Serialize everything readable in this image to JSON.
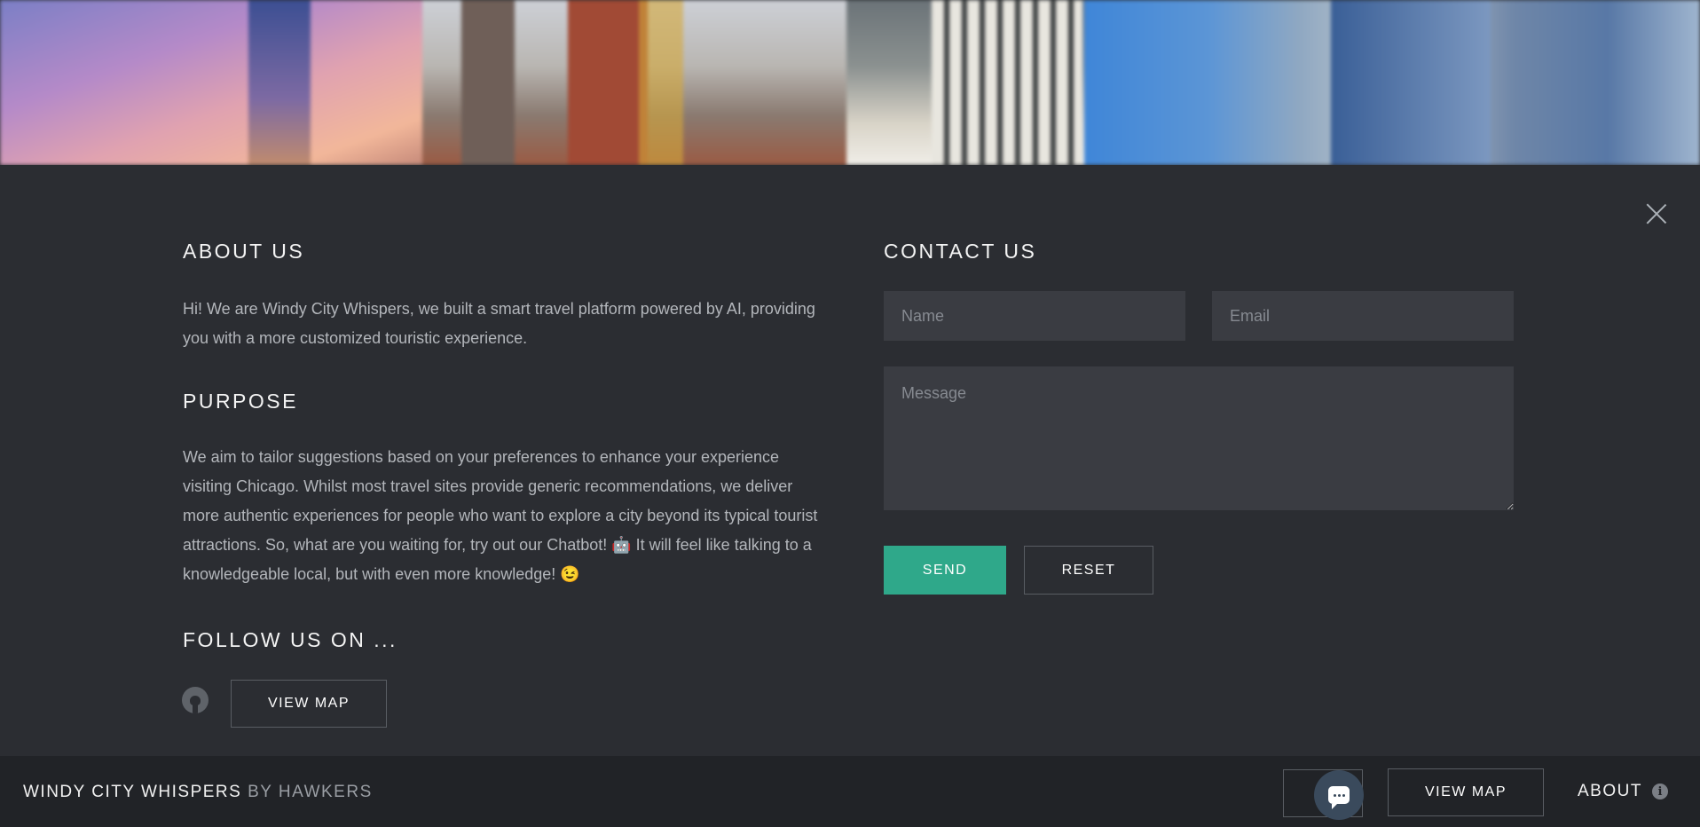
{
  "about": {
    "heading": "ABOUT US",
    "text": "Hi! We are Windy City Whispers, we built a smart travel platform powered by AI, providing you with a more customized touristic experience."
  },
  "purpose": {
    "heading": "PURPOSE",
    "text": "We aim to tailor suggestions based on your preferences to enhance your experience visiting Chicago. Whilst most travel sites provide generic recommendations, we deliver more authentic experiences for people who want to explore a city beyond its typical tourist attractions. So, what are you waiting for, try out our Chatbot! 🤖 It will feel like talking to a knowledgeable local, but with even more knowledge! 😉"
  },
  "follow": {
    "heading": "FOLLOW US ON ...",
    "view_map_label": "VIEW MAP"
  },
  "contact": {
    "heading": "CONTACT US",
    "name_placeholder": "Name",
    "email_placeholder": "Email",
    "message_placeholder": "Message",
    "send_label": "SEND",
    "reset_label": "RESET"
  },
  "footer": {
    "brand": "WINDY CITY WHISPERS",
    "brand_suffix": "BY HAWKERS",
    "view_map_label": "VIEW MAP",
    "about_label": "ABOUT",
    "info_glyph": "i"
  },
  "icons": {
    "close": "close-icon",
    "github": "github-icon",
    "chat": "chat-icon",
    "info": "info-icon"
  },
  "colors": {
    "accent": "#2fa88a",
    "panel_bg": "#2b2d32",
    "footer_bg": "#212327"
  }
}
